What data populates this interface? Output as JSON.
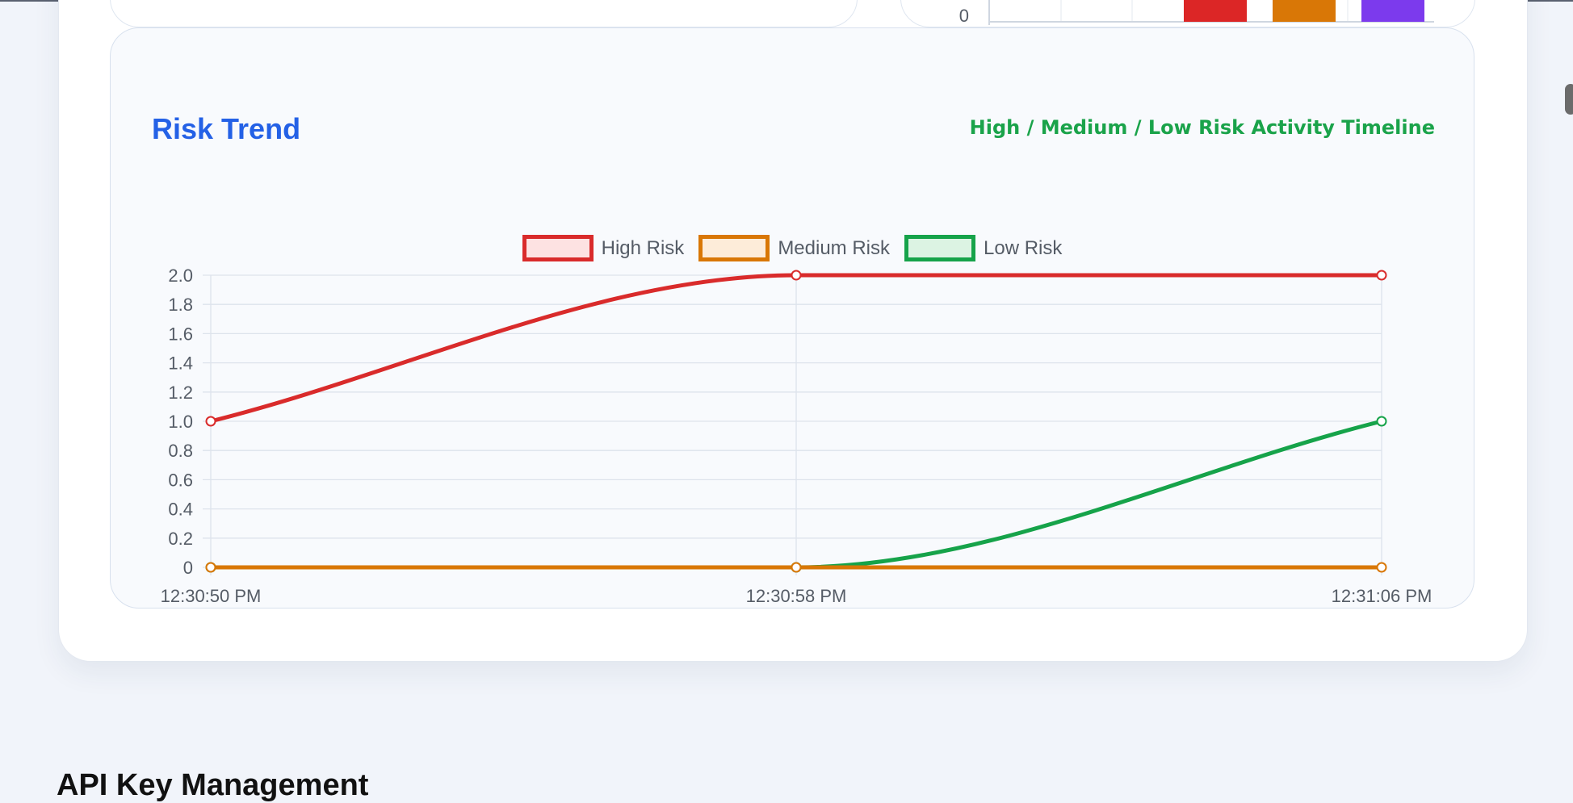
{
  "colors": {
    "high_risk": "#d92b2b",
    "medium_risk": "#d97706",
    "low_risk": "#16a34a",
    "title_blue": "#2461e6",
    "bar_purple": "#7c3aed"
  },
  "partial_bar_chart": {
    "y_tick_zero": "0",
    "bar_colors": [
      "#dc2626",
      "#d97706",
      "#7c3aed"
    ]
  },
  "risk_trend": {
    "title": "Risk Trend",
    "subtitle": "High / Medium / Low Risk Activity Timeline"
  },
  "chart_data": {
    "type": "line",
    "title": "",
    "xlabel": "",
    "ylabel": "",
    "categories": [
      "12:30:50 PM",
      "12:30:58 PM",
      "12:31:06 PM"
    ],
    "y_ticks": [
      "0",
      "0.2",
      "0.4",
      "0.6",
      "0.8",
      "1.0",
      "1.2",
      "1.4",
      "1.6",
      "1.8",
      "2.0"
    ],
    "ylim": [
      0,
      2
    ],
    "grid": true,
    "legend_position": "top-center",
    "series": [
      {
        "name": "High Risk",
        "values": [
          1,
          2,
          2
        ],
        "color": "#d92b2b",
        "fill": "#fde2e2"
      },
      {
        "name": "Medium Risk",
        "values": [
          0,
          0,
          0
        ],
        "color": "#d97706",
        "fill": "#fdecd9"
      },
      {
        "name": "Low Risk",
        "values": [
          0,
          0,
          1
        ],
        "color": "#16a34a",
        "fill": "#dcf3e3"
      }
    ]
  },
  "next_section": {
    "heading": "API Key Management"
  }
}
